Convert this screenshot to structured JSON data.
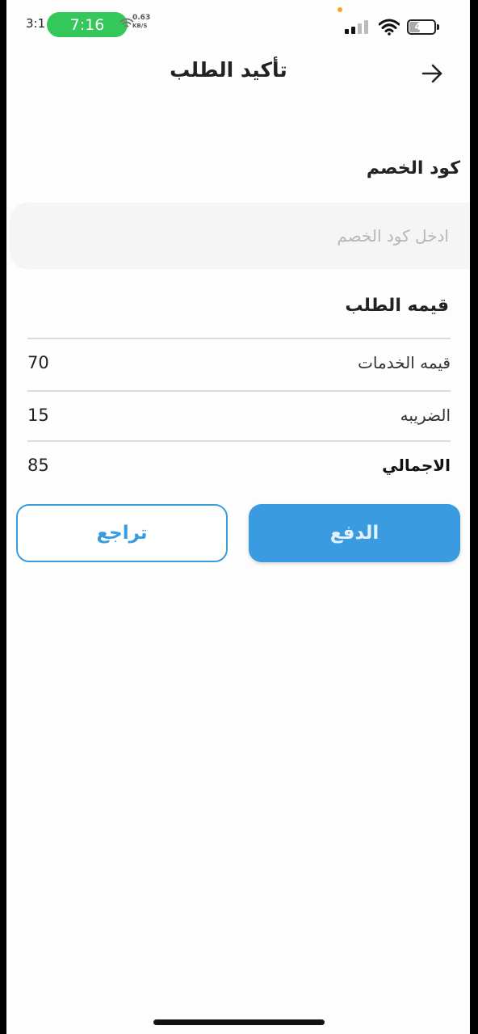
{
  "status_bar": {
    "clock_under": "3:1",
    "pill_time": "7:16",
    "net_speed_value": "0.63",
    "net_speed_unit": "KB/S",
    "battery_percent": "40",
    "battery_charging": "4",
    "colors": {
      "pill": "#34c759",
      "dot": "#f5a623"
    }
  },
  "header": {
    "title": "تأكيد الطلب",
    "back_icon": "arrow-right-icon"
  },
  "discount": {
    "label": "كود الخصم",
    "input_value": "",
    "placeholder": "ادخل كود الخصم"
  },
  "summary": {
    "title": "قيمه الطلب",
    "rows": [
      {
        "label": "قيمه الخدمات",
        "value": "70"
      },
      {
        "label": "الضريبه",
        "value": "15"
      },
      {
        "label": "الاجمالي",
        "value": "85"
      }
    ]
  },
  "actions": {
    "pay_label": "الدفع",
    "back_label": "تراجع",
    "accent_color": "#3b9be0"
  }
}
